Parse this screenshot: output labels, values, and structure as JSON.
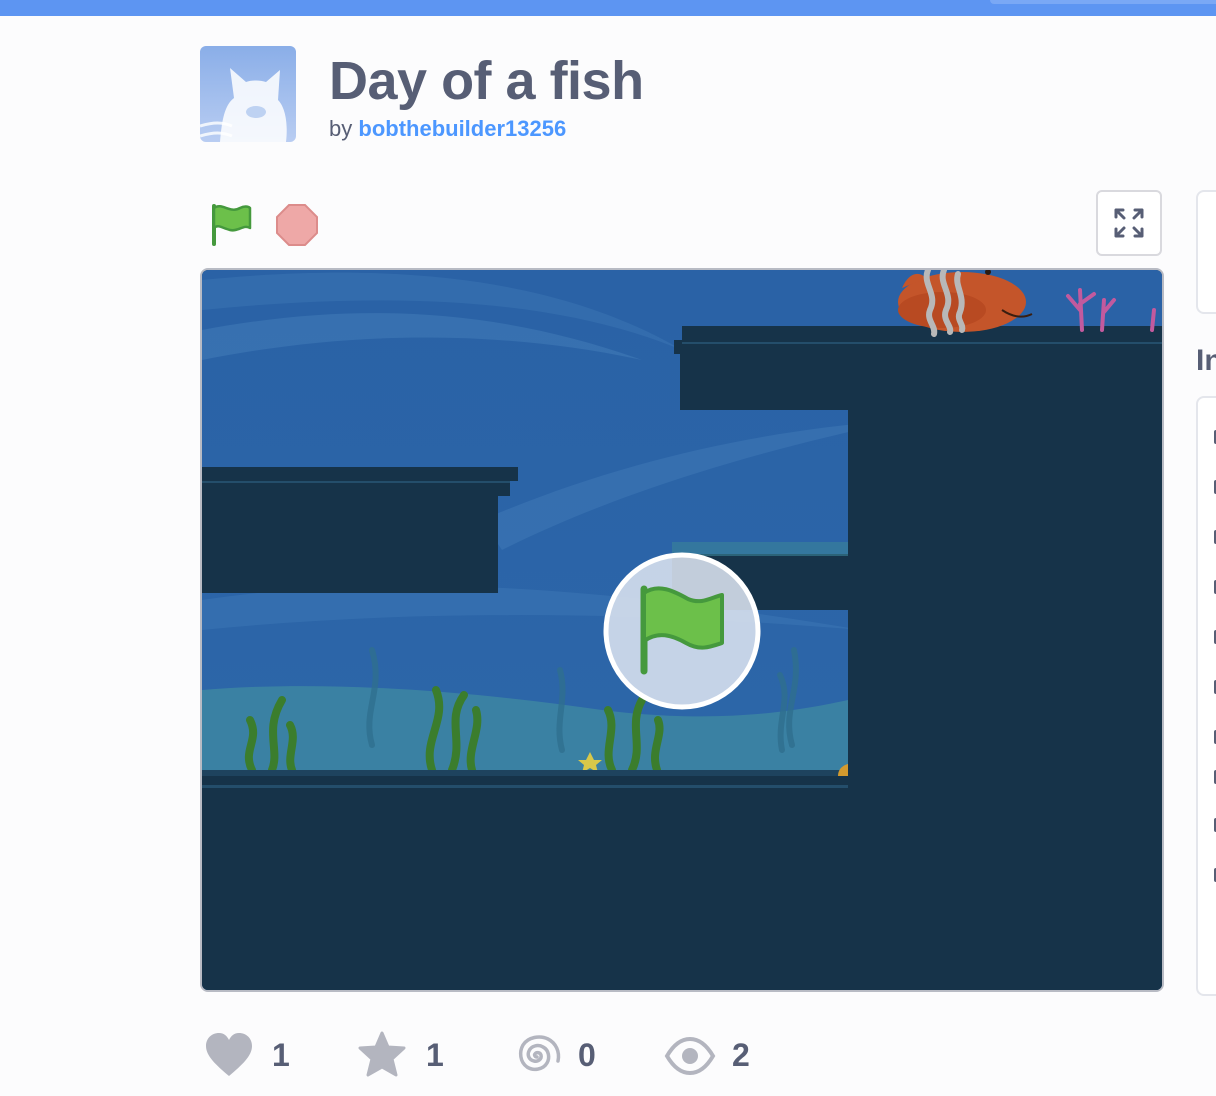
{
  "project": {
    "title": "Day of a fish",
    "by_prefix": "by",
    "author": "bobthebuilder13256"
  },
  "controls": {
    "green_flag": "green-flag-icon",
    "stop": "stop-icon",
    "fullscreen": "fullscreen-icon",
    "play_overlay": "green-flag-icon"
  },
  "sidebar": {
    "heading_fragment": "In"
  },
  "stats": {
    "loves": "1",
    "favorites": "1",
    "remixes": "0",
    "views": "2"
  },
  "colors": {
    "accent": "#4c97ff",
    "topbar": "#5d95f2",
    "text": "#575e75",
    "stage_dark": "#163349",
    "water": "#2a65a8",
    "flag_green": "#6cc04a",
    "stop_red": "#eea8a7"
  }
}
